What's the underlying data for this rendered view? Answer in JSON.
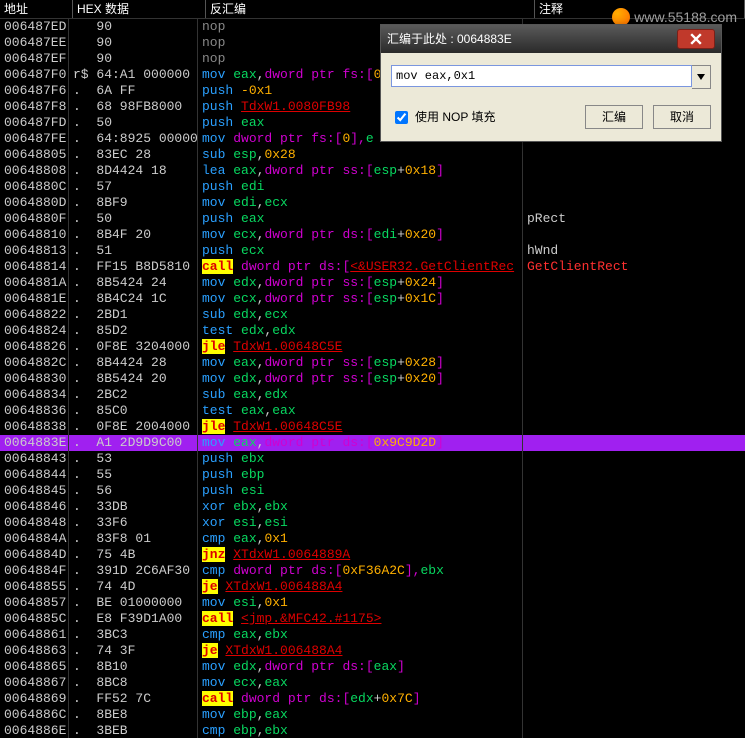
{
  "headers": {
    "addr": "地址",
    "hex": "HEX 数据",
    "disasm": "反汇编",
    "cmt": "注释"
  },
  "dialog": {
    "title": "汇编于此处 : 0064883E",
    "input": "mov eax,0x1",
    "check": "使用 NOP 填充",
    "ok": "汇编",
    "cancel": "取消"
  },
  "watermark": "www.55188.com",
  "rows": [
    {
      "a": "006487ED",
      "h": "   90",
      "d": [
        [
          "nop",
          "mn-nop"
        ]
      ]
    },
    {
      "a": "006487EE",
      "h": "   90",
      "d": [
        [
          "nop",
          "mn-nop"
        ]
      ]
    },
    {
      "a": "006487EF",
      "h": "   90",
      "d": [
        [
          "nop",
          "mn-nop"
        ]
      ]
    },
    {
      "a": "006487F0",
      "h": "r$ 64:A1 000000",
      "d": [
        [
          "mov ",
          "mn-mov"
        ],
        [
          "eax",
          "reg"
        ],
        [
          ",",
          ""
        ],
        [
          "dword ptr fs:[",
          "ptr"
        ],
        [
          "0",
          "num"
        ],
        [
          "]",
          "ptr"
        ]
      ]
    },
    {
      "a": "006487F6",
      "h": ".  6A FF",
      "d": [
        [
          "push ",
          "mn-push"
        ],
        [
          "-0x1",
          "num"
        ]
      ]
    },
    {
      "a": "006487F8",
      "h": ".  68 98FB8000",
      "d": [
        [
          "push ",
          "mn-push"
        ],
        [
          "TdxW1.0080FB98",
          "addr-op"
        ]
      ]
    },
    {
      "a": "006487FD",
      "h": ".  50",
      "d": [
        [
          "push ",
          "mn-push"
        ],
        [
          "eax",
          "reg"
        ]
      ]
    },
    {
      "a": "006487FE",
      "h": ".  64:8925 00000",
      "d": [
        [
          "mov ",
          "mn-mov"
        ],
        [
          "dword ptr fs:[",
          "ptr"
        ],
        [
          "0",
          "num"
        ],
        [
          "],",
          "ptr"
        ],
        [
          "e",
          "reg"
        ]
      ]
    },
    {
      "a": "00648805",
      "h": ".  83EC 28",
      "d": [
        [
          "sub ",
          "mn-sub"
        ],
        [
          "esp",
          "reg"
        ],
        [
          ",",
          ""
        ],
        [
          "0x28",
          "num"
        ]
      ]
    },
    {
      "a": "00648808",
      "h": ".  8D4424 18",
      "d": [
        [
          "lea ",
          "mn-lea"
        ],
        [
          "eax",
          "reg"
        ],
        [
          ",",
          ""
        ],
        [
          "dword ptr ss:[",
          "ptr"
        ],
        [
          "esp",
          "reg"
        ],
        [
          "+",
          ""
        ],
        [
          "0x18",
          "num"
        ],
        [
          "]",
          "ptr"
        ]
      ]
    },
    {
      "a": "0064880C",
      "h": ".  57",
      "d": [
        [
          "push ",
          "mn-push"
        ],
        [
          "edi",
          "reg"
        ]
      ]
    },
    {
      "a": "0064880D",
      "h": ".  8BF9",
      "d": [
        [
          "mov ",
          "mn-mov"
        ],
        [
          "edi",
          "reg"
        ],
        [
          ",",
          ""
        ],
        [
          "ecx",
          "reg"
        ]
      ]
    },
    {
      "a": "0064880F",
      "h": ".  50",
      "d": [
        [
          "push ",
          "mn-push"
        ],
        [
          "eax",
          "reg"
        ]
      ],
      "c": "pRect"
    },
    {
      "a": "00648810",
      "h": ".  8B4F 20",
      "d": [
        [
          "mov ",
          "mn-mov"
        ],
        [
          "ecx",
          "reg"
        ],
        [
          ",",
          ""
        ],
        [
          "dword ptr ds:[",
          "ptr"
        ],
        [
          "edi",
          "reg"
        ],
        [
          "+",
          ""
        ],
        [
          "0x20",
          "num"
        ],
        [
          "]",
          "ptr"
        ]
      ]
    },
    {
      "a": "00648813",
      "h": ".  51",
      "d": [
        [
          "push ",
          "mn-push"
        ],
        [
          "ecx",
          "reg"
        ]
      ],
      "c": "hWnd"
    },
    {
      "a": "00648814",
      "h": ".  FF15 B8D5810",
      "d": [
        [
          "call",
          "mn-call-hl"
        ],
        [
          " ",
          ""
        ],
        [
          "dword ptr ds:[",
          "ptr"
        ],
        [
          "<&USER32.GetClientRec",
          "addr-op"
        ]
      ],
      "c": "GetClientRect",
      "cr": true
    },
    {
      "a": "0064881A",
      "h": ".  8B5424 24",
      "d": [
        [
          "mov ",
          "mn-mov"
        ],
        [
          "edx",
          "reg"
        ],
        [
          ",",
          ""
        ],
        [
          "dword ptr ss:[",
          "ptr"
        ],
        [
          "esp",
          "reg"
        ],
        [
          "+",
          ""
        ],
        [
          "0x24",
          "num"
        ],
        [
          "]",
          "ptr"
        ]
      ]
    },
    {
      "a": "0064881E",
      "h": ".  8B4C24 1C",
      "d": [
        [
          "mov ",
          "mn-mov"
        ],
        [
          "ecx",
          "reg"
        ],
        [
          ",",
          ""
        ],
        [
          "dword ptr ss:[",
          "ptr"
        ],
        [
          "esp",
          "reg"
        ],
        [
          "+",
          ""
        ],
        [
          "0x1C",
          "num"
        ],
        [
          "]",
          "ptr"
        ]
      ]
    },
    {
      "a": "00648822",
      "h": ".  2BD1",
      "d": [
        [
          "sub ",
          "mn-sub"
        ],
        [
          "edx",
          "reg"
        ],
        [
          ",",
          ""
        ],
        [
          "ecx",
          "reg"
        ]
      ]
    },
    {
      "a": "00648824",
      "h": ".  85D2",
      "d": [
        [
          "test ",
          "mn-test"
        ],
        [
          "edx",
          "reg"
        ],
        [
          ",",
          ""
        ],
        [
          "edx",
          "reg"
        ]
      ]
    },
    {
      "a": "00648826",
      "h": ".  0F8E 3204000",
      "d": [
        [
          "jle",
          "mn-j"
        ],
        [
          " ",
          ""
        ],
        [
          "TdxW1.00648C5E",
          "addr-op"
        ]
      ]
    },
    {
      "a": "0064882C",
      "h": ".  8B4424 28",
      "d": [
        [
          "mov ",
          "mn-mov"
        ],
        [
          "eax",
          "reg"
        ],
        [
          ",",
          ""
        ],
        [
          "dword ptr ss:[",
          "ptr"
        ],
        [
          "esp",
          "reg"
        ],
        [
          "+",
          ""
        ],
        [
          "0x28",
          "num"
        ],
        [
          "]",
          "ptr"
        ]
      ]
    },
    {
      "a": "00648830",
      "h": ".  8B5424 20",
      "d": [
        [
          "mov ",
          "mn-mov"
        ],
        [
          "edx",
          "reg"
        ],
        [
          ",",
          ""
        ],
        [
          "dword ptr ss:[",
          "ptr"
        ],
        [
          "esp",
          "reg"
        ],
        [
          "+",
          ""
        ],
        [
          "0x20",
          "num"
        ],
        [
          "]",
          "ptr"
        ]
      ]
    },
    {
      "a": "00648834",
      "h": ".  2BC2",
      "d": [
        [
          "sub ",
          "mn-sub"
        ],
        [
          "eax",
          "reg"
        ],
        [
          ",",
          ""
        ],
        [
          "edx",
          "reg"
        ]
      ]
    },
    {
      "a": "00648836",
      "h": ".  85C0",
      "d": [
        [
          "test ",
          "mn-test"
        ],
        [
          "eax",
          "reg"
        ],
        [
          ",",
          ""
        ],
        [
          "eax",
          "reg"
        ]
      ]
    },
    {
      "a": "00648838",
      "h": ".  0F8E 2004000",
      "d": [
        [
          "jle",
          "mn-j"
        ],
        [
          " ",
          ""
        ],
        [
          "TdxW1.00648C5E",
          "addr-op"
        ]
      ]
    },
    {
      "a": "0064883E",
      "h": ".  A1 2D9D9C00",
      "sel": true,
      "d": [
        [
          "mov ",
          "mn-mov"
        ],
        [
          "eax",
          "reg"
        ],
        [
          ",",
          ""
        ],
        [
          "dword ptr ds:[",
          "ptr"
        ],
        [
          "0x9C9D2D",
          "num"
        ],
        [
          "]",
          "ptr"
        ]
      ]
    },
    {
      "a": "00648843",
      "h": ".  53",
      "d": [
        [
          "push ",
          "mn-push"
        ],
        [
          "ebx",
          "reg"
        ]
      ]
    },
    {
      "a": "00648844",
      "h": ".  55",
      "d": [
        [
          "push ",
          "mn-push"
        ],
        [
          "ebp",
          "reg"
        ]
      ]
    },
    {
      "a": "00648845",
      "h": ".  56",
      "d": [
        [
          "push ",
          "mn-push"
        ],
        [
          "esi",
          "reg"
        ]
      ]
    },
    {
      "a": "00648846",
      "h": ".  33DB",
      "d": [
        [
          "xor ",
          "mn-xor"
        ],
        [
          "ebx",
          "reg"
        ],
        [
          ",",
          ""
        ],
        [
          "ebx",
          "reg"
        ]
      ]
    },
    {
      "a": "00648848",
      "h": ".  33F6",
      "d": [
        [
          "xor ",
          "mn-xor"
        ],
        [
          "esi",
          "reg"
        ],
        [
          ",",
          ""
        ],
        [
          "esi",
          "reg"
        ]
      ]
    },
    {
      "a": "0064884A",
      "h": ".  83F8 01",
      "d": [
        [
          "cmp ",
          "mn-cmp"
        ],
        [
          "eax",
          "reg"
        ],
        [
          ",",
          ""
        ],
        [
          "0x1",
          "num"
        ]
      ]
    },
    {
      "a": "0064884D",
      "h": ".  75 4B",
      "d": [
        [
          "jnz",
          "mn-j"
        ],
        [
          " ",
          ""
        ],
        [
          "XTdxW1.0064889A",
          "addr-op"
        ]
      ]
    },
    {
      "a": "0064884F",
      "h": ".  391D 2C6AF30",
      "d": [
        [
          "cmp ",
          "mn-cmp"
        ],
        [
          "dword ptr ds:[",
          "ptr"
        ],
        [
          "0xF36A2C",
          "num"
        ],
        [
          "],",
          "ptr"
        ],
        [
          "ebx",
          "reg"
        ]
      ]
    },
    {
      "a": "00648855",
      "h": ".  74 4D",
      "d": [
        [
          "je",
          "mn-j"
        ],
        [
          " ",
          ""
        ],
        [
          "XTdxW1.006488A4",
          "addr-op"
        ]
      ]
    },
    {
      "a": "00648857",
      "h": ".  BE 01000000",
      "d": [
        [
          "mov ",
          "mn-mov"
        ],
        [
          "esi",
          "reg"
        ],
        [
          ",",
          ""
        ],
        [
          "0x1",
          "num"
        ]
      ]
    },
    {
      "a": "0064885C",
      "h": ".  E8 F39D1A00",
      "d": [
        [
          "call",
          "mn-call-hl"
        ],
        [
          " ",
          ""
        ],
        [
          "<jmp.&MFC42.#1175>",
          "addr-op"
        ]
      ]
    },
    {
      "a": "00648861",
      "h": ".  3BC3",
      "d": [
        [
          "cmp ",
          "mn-cmp"
        ],
        [
          "eax",
          "reg"
        ],
        [
          ",",
          ""
        ],
        [
          "ebx",
          "reg"
        ]
      ]
    },
    {
      "a": "00648863",
      "h": ".  74 3F",
      "d": [
        [
          "je",
          "mn-j"
        ],
        [
          " ",
          ""
        ],
        [
          "XTdxW1.006488A4",
          "addr-op"
        ]
      ]
    },
    {
      "a": "00648865",
      "h": ".  8B10",
      "d": [
        [
          "mov ",
          "mn-mov"
        ],
        [
          "edx",
          "reg"
        ],
        [
          ",",
          ""
        ],
        [
          "dword ptr ds:[",
          "ptr"
        ],
        [
          "eax",
          "reg"
        ],
        [
          "]",
          "ptr"
        ]
      ]
    },
    {
      "a": "00648867",
      "h": ".  8BC8",
      "d": [
        [
          "mov ",
          "mn-mov"
        ],
        [
          "ecx",
          "reg"
        ],
        [
          ",",
          ""
        ],
        [
          "eax",
          "reg"
        ]
      ]
    },
    {
      "a": "00648869",
      "h": ".  FF52 7C",
      "d": [
        [
          "call",
          "mn-call-hl"
        ],
        [
          " ",
          ""
        ],
        [
          "dword ptr ds:[",
          "ptr"
        ],
        [
          "edx",
          "reg"
        ],
        [
          "+",
          ""
        ],
        [
          "0x7C",
          "num"
        ],
        [
          "]",
          "ptr"
        ]
      ]
    },
    {
      "a": "0064886C",
      "h": ".  8BE8",
      "d": [
        [
          "mov ",
          "mn-mov"
        ],
        [
          "ebp",
          "reg"
        ],
        [
          ",",
          ""
        ],
        [
          "eax",
          "reg"
        ]
      ]
    },
    {
      "a": "0064886E",
      "h": ".  3BEB",
      "d": [
        [
          "cmp ",
          "mn-cmp"
        ],
        [
          "ebp",
          "reg"
        ],
        [
          ",",
          ""
        ],
        [
          "ebx",
          "reg"
        ]
      ]
    }
  ]
}
